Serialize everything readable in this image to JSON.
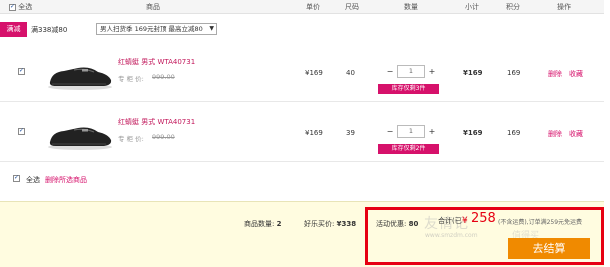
{
  "header": {
    "select_all": "全选",
    "product": "商品",
    "unit_price": "单价",
    "size": "尺码",
    "quantity": "数量",
    "subtotal": "小计",
    "points": "积分",
    "action": "操作"
  },
  "promo": {
    "tag": "满减",
    "text": "满338减80",
    "select_value": "男人扫货季 169元封顶 最高立减80"
  },
  "items": [
    {
      "name": "红蜻蜓 男式 WTA40731",
      "price_label": "专 柜 价:",
      "original_price": "999.00",
      "price": "¥169",
      "size": "40",
      "qty": "1",
      "minus": "−",
      "plus": "+",
      "stock": "库存仅剩3件",
      "subtotal": "¥169",
      "points": "169",
      "delete": "删除",
      "favorite": "收藏"
    },
    {
      "name": "红蜻蜓 男式 WTA40731",
      "price_label": "专 柜 价:",
      "original_price": "999.00",
      "price": "¥169",
      "size": "39",
      "qty": "1",
      "minus": "−",
      "plus": "+",
      "stock": "库存仅剩2件",
      "subtotal": "¥169",
      "points": "169",
      "delete": "删除",
      "favorite": "收藏"
    }
  ],
  "footer": {
    "select_all": "全选",
    "delete_selected": "删除所选商品"
  },
  "summary": {
    "count_label": "商品数量:",
    "count": "2",
    "price_label": "好乐买价:",
    "price": "¥338",
    "discount_label": "活动优惠:",
    "discount": "80",
    "total_label": "合计(已",
    "currency": "¥",
    "total": "258",
    "note": "(不含运费),订单满259元免运费",
    "checkout": "去结算"
  },
  "watermark": {
    "logo": "友情记",
    "site": "www.smzdm.com",
    "slogan": "值得买"
  },
  "colors": {
    "accent": "#d6116b",
    "highlight_border": "#e60012",
    "checkout_bg": "#f08a00",
    "summary_bg": "#fffce0"
  }
}
